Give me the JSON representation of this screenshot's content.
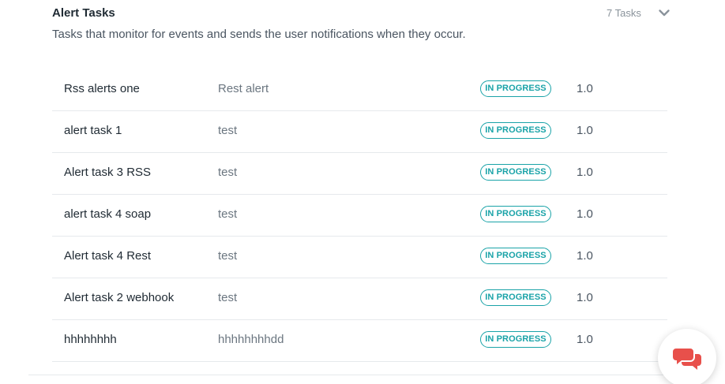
{
  "section": {
    "title": "Alert Tasks",
    "description": "Tasks that monitor for events and sends the user notifications when they occur.",
    "task_count": "7 Tasks",
    "toggle_icon": "chevron-down-icon"
  },
  "tasks": [
    {
      "name": "Rss alerts one",
      "type": "Rest alert",
      "status": "IN PROGRESS",
      "version": "1.0"
    },
    {
      "name": "alert task 1",
      "type": "test",
      "status": "IN PROGRESS",
      "version": "1.0"
    },
    {
      "name": "Alert task 3 RSS",
      "type": "test",
      "status": "IN PROGRESS",
      "version": "1.0"
    },
    {
      "name": "alert task 4 soap",
      "type": "test",
      "status": "IN PROGRESS",
      "version": "1.0"
    },
    {
      "name": "Alert task 4 Rest",
      "type": "test",
      "status": "IN PROGRESS",
      "version": "1.0"
    },
    {
      "name": "Alert task 2 webhook",
      "type": "test",
      "status": "IN PROGRESS",
      "version": "1.0"
    },
    {
      "name": "hhhhhhhh",
      "type": "hhhhhhhhdd",
      "status": "IN PROGRESS",
      "version": "1.0"
    }
  ],
  "colors": {
    "status_accent": "#1aa3a8",
    "chat_icon": "#e8504b"
  },
  "chat": {
    "icon": "chat-bubbles-icon"
  }
}
